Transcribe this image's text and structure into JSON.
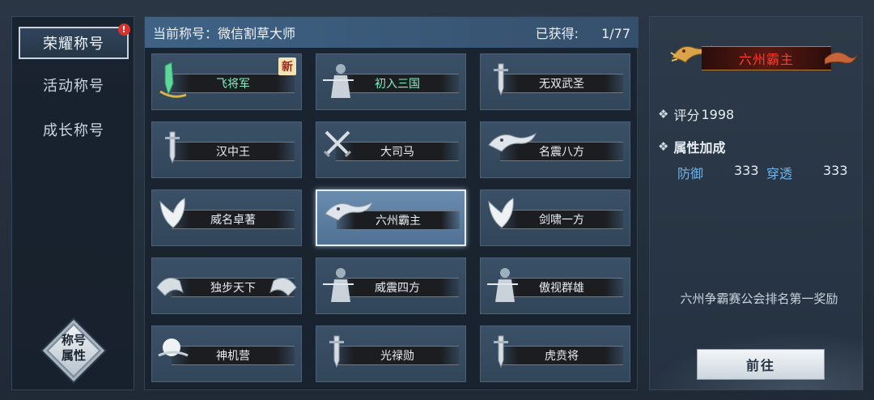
{
  "sidebar": {
    "tabs": [
      {
        "label": "荣耀称号",
        "active": true,
        "badge": "!"
      },
      {
        "label": "活动称号",
        "active": false
      },
      {
        "label": "成长称号",
        "active": false
      }
    ],
    "attr_button": {
      "line1": "称号",
      "line2": "属性"
    }
  },
  "header": {
    "current_label": "当前称号：",
    "current_value": "微信割草大师",
    "obtained_label": "已获得:",
    "obtained_count": "1/77"
  },
  "titles": [
    {
      "label": "飞将军",
      "style": "green",
      "new": "新",
      "icon": "jade-sword-icon"
    },
    {
      "label": "初入三国",
      "style": "green",
      "icon": "warrior-icon"
    },
    {
      "label": "无双武圣",
      "icon": "sword-icon"
    },
    {
      "label": "汉中王",
      "icon": "sword-icon"
    },
    {
      "label": "大司马",
      "icon": "crossed-swords-icon"
    },
    {
      "label": "名震八方",
      "icon": "dragon-icon"
    },
    {
      "label": "威名卓著",
      "icon": "wings-icon"
    },
    {
      "label": "六州霸主",
      "icon": "dragon-icon",
      "selected": true
    },
    {
      "label": "剑啸一方",
      "icon": "wings-icon"
    },
    {
      "label": "独步天下",
      "icon": "bat-wings-icon"
    },
    {
      "label": "威震四方",
      "icon": "warrior-icon"
    },
    {
      "label": "傲视群雄",
      "icon": "warrior-icon"
    },
    {
      "label": "神机营",
      "icon": "moon-icon"
    },
    {
      "label": "光禄勋",
      "icon": "sword-icon"
    },
    {
      "label": "虎贲将",
      "icon": "sword-icon"
    }
  ],
  "detail": {
    "title_name": "六州霸主",
    "score_label": "评分",
    "score_value": "1998",
    "attr_header": "属性加成",
    "attrs": [
      {
        "name": "防御",
        "value": "333"
      },
      {
        "name": "穿透",
        "value": "333"
      }
    ],
    "description": "六州争霸赛公会排名第一奖励",
    "go_button": "前往"
  },
  "colors": {
    "accent_blue": "#6fb4ea",
    "title_red": "#ff3b2f",
    "green_title": "#7ff3c4",
    "badge_red": "#d8322d"
  }
}
